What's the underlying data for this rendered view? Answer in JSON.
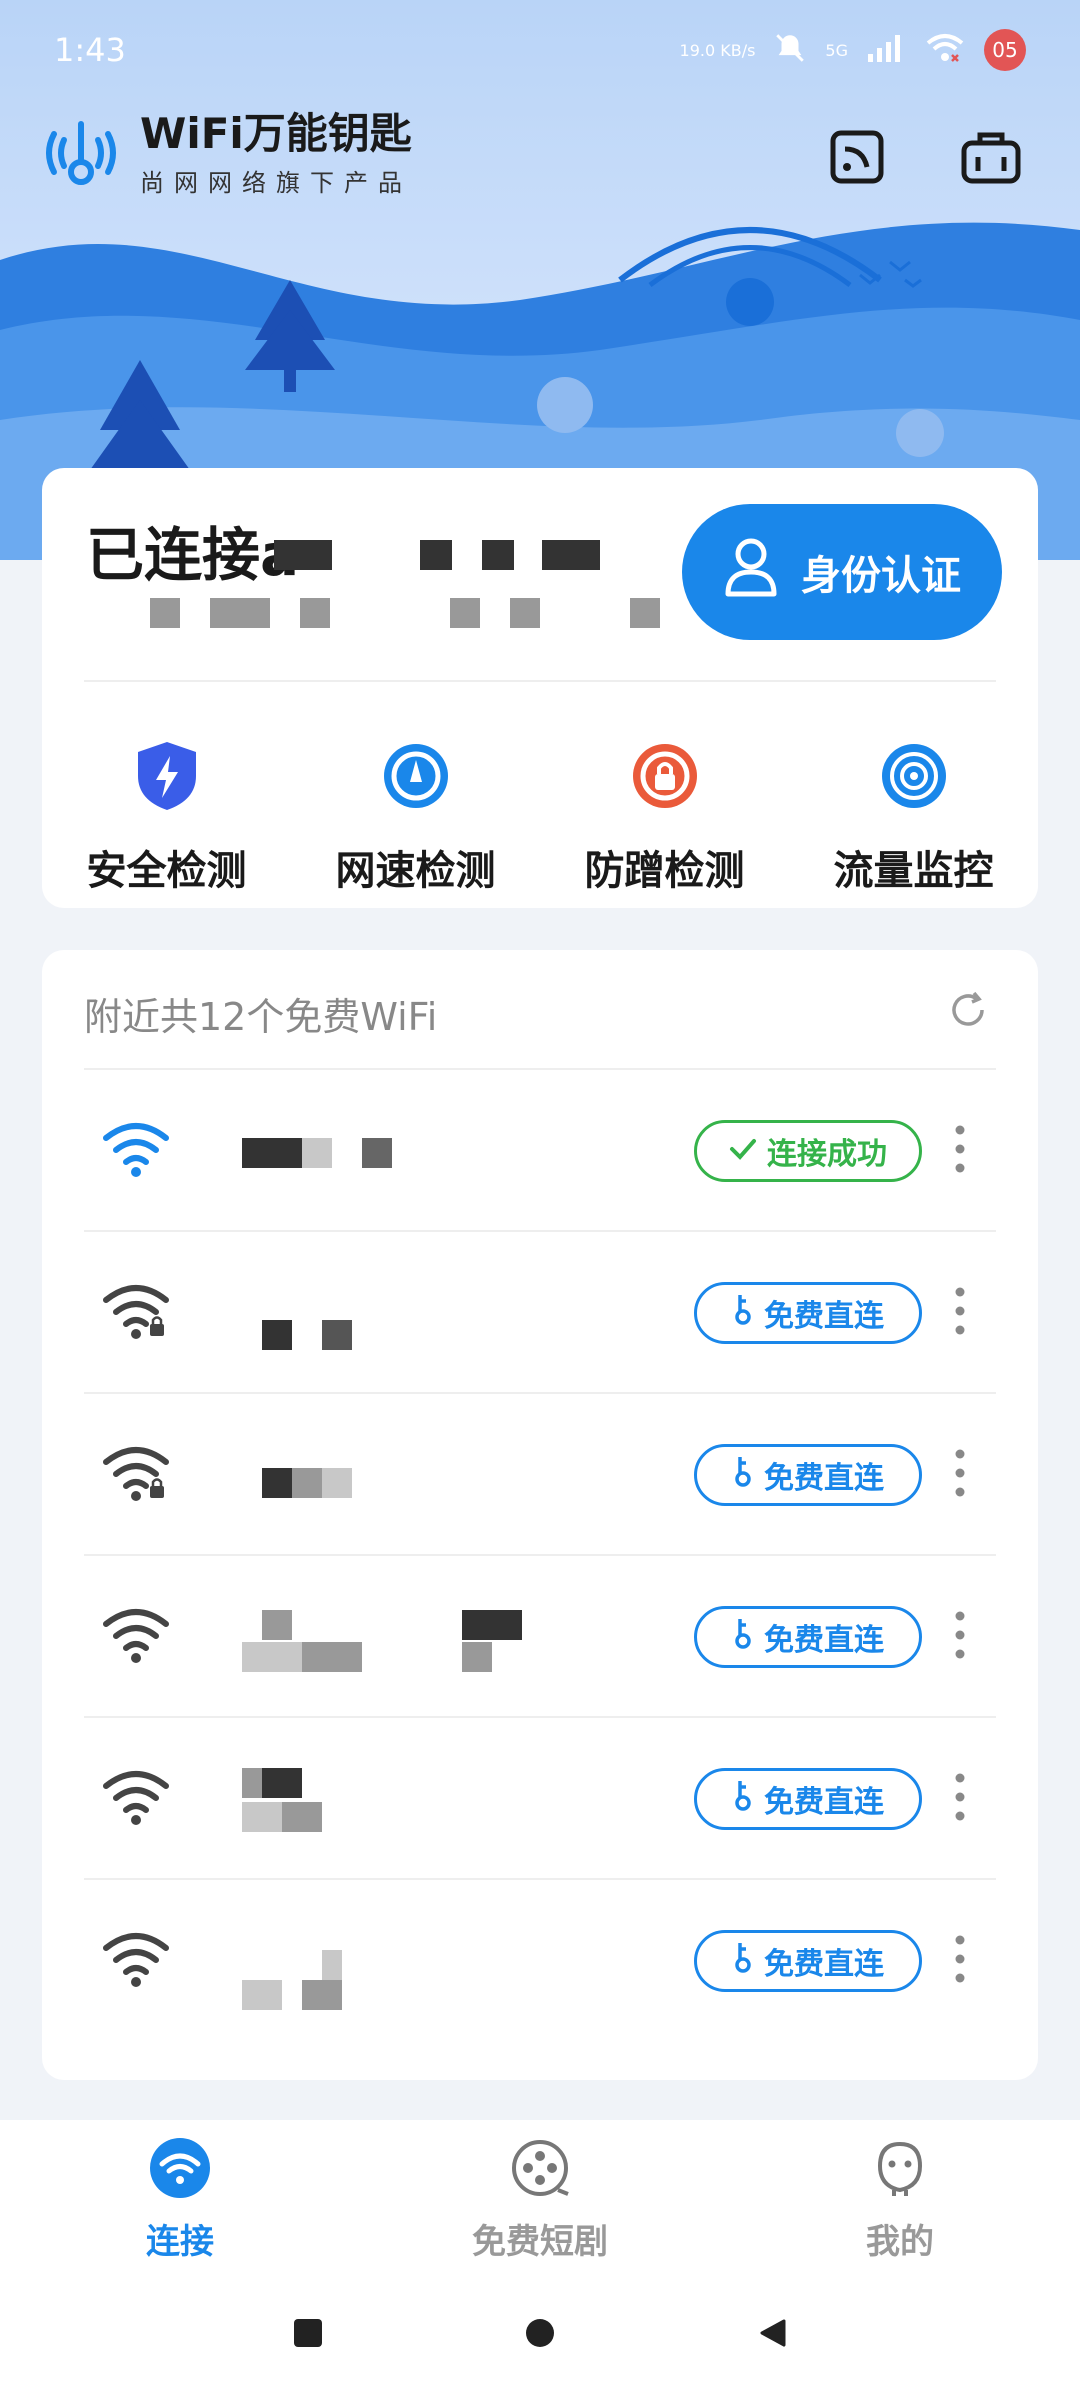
{
  "status_bar": {
    "time": "1:43",
    "net_speed": "19.0 KB/s",
    "signal_label": "5G",
    "notification_count": "05"
  },
  "brand": {
    "title": "WiFi万能钥匙",
    "subtitle": "尚网网络旗下产品"
  },
  "header_icons": [
    "screen-cast-icon",
    "toolbox-icon"
  ],
  "connection": {
    "status_prefix": "已连接a",
    "auth_button_label": "身份认证"
  },
  "tools": [
    {
      "label": "安全检测",
      "icon": "shield-bolt-icon",
      "color": "#3a5de8"
    },
    {
      "label": "网速检测",
      "icon": "speedometer-icon",
      "color": "#1a87ea"
    },
    {
      "label": "防蹭检测",
      "icon": "lock-circle-icon",
      "color": "#ea5a3a"
    },
    {
      "label": "流量监控",
      "icon": "signal-pin-icon",
      "color": "#1a87ea"
    }
  ],
  "nearby": {
    "heading": "附近共12个免费WiFi",
    "networks": [
      {
        "action": "连接成功",
        "state": "connected",
        "locked": false
      },
      {
        "action": "免费直连",
        "state": "available",
        "locked": true
      },
      {
        "action": "免费直连",
        "state": "available",
        "locked": true
      },
      {
        "action": "免费直连",
        "state": "available",
        "locked": false
      },
      {
        "action": "免费直连",
        "state": "available",
        "locked": false
      },
      {
        "action": "免费直连",
        "state": "available",
        "locked": false
      }
    ]
  },
  "bottom_nav": [
    {
      "label": "连接",
      "icon": "wifi-icon",
      "active": true
    },
    {
      "label": "免费短剧",
      "icon": "film-reel-icon",
      "active": false
    },
    {
      "label": "我的",
      "icon": "profile-face-icon",
      "active": false
    }
  ],
  "colors": {
    "accent": "#1a87ea",
    "success": "#35b34a"
  }
}
